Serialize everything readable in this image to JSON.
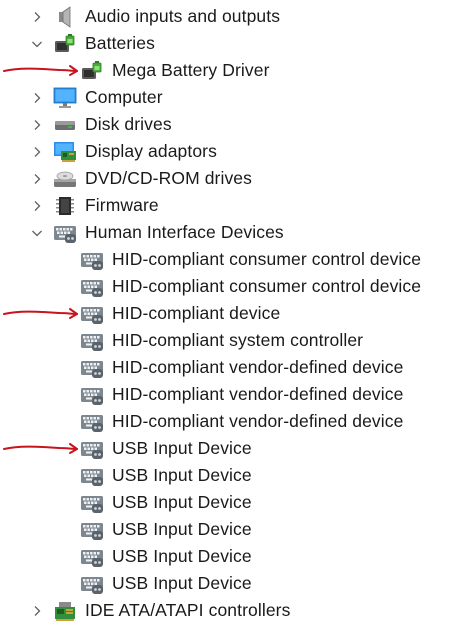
{
  "tree": {
    "categories": [
      {
        "label": "Audio inputs and outputs",
        "expanded": false,
        "icon": "speaker-icon"
      },
      {
        "label": "Batteries",
        "expanded": true,
        "icon": "battery-icon",
        "children": [
          {
            "label": "Mega Battery Driver",
            "icon": "battery-icon",
            "marked": true
          }
        ]
      },
      {
        "label": "Computer",
        "expanded": false,
        "icon": "monitor-icon"
      },
      {
        "label": "Disk drives",
        "expanded": false,
        "icon": "disk-drive-icon"
      },
      {
        "label": "Display adaptors",
        "expanded": false,
        "icon": "display-adapter-icon"
      },
      {
        "label": "DVD/CD-ROM drives",
        "expanded": false,
        "icon": "dvd-drive-icon"
      },
      {
        "label": "Firmware",
        "expanded": false,
        "icon": "chip-icon"
      },
      {
        "label": "Human Interface Devices",
        "expanded": true,
        "icon": "hid-icon",
        "children": [
          {
            "label": "HID-compliant consumer control device",
            "icon": "hid-icon"
          },
          {
            "label": "HID-compliant consumer control device",
            "icon": "hid-icon"
          },
          {
            "label": "HID-compliant device",
            "icon": "hid-icon",
            "marked": true
          },
          {
            "label": "HID-compliant system controller",
            "icon": "hid-icon"
          },
          {
            "label": "HID-compliant vendor-defined device",
            "icon": "hid-icon"
          },
          {
            "label": "HID-compliant vendor-defined device",
            "icon": "hid-icon"
          },
          {
            "label": "HID-compliant vendor-defined device",
            "icon": "hid-icon"
          },
          {
            "label": "USB Input Device",
            "icon": "hid-icon",
            "marked": true
          },
          {
            "label": "USB Input Device",
            "icon": "hid-icon"
          },
          {
            "label": "USB Input Device",
            "icon": "hid-icon"
          },
          {
            "label": "USB Input Device",
            "icon": "hid-icon"
          },
          {
            "label": "USB Input Device",
            "icon": "hid-icon"
          },
          {
            "label": "USB Input Device",
            "icon": "hid-icon"
          }
        ]
      },
      {
        "label": "IDE ATA/ATAPI controllers",
        "expanded": false,
        "icon": "ide-controller-icon"
      }
    ]
  },
  "colors": {
    "annotation": "#c8141e",
    "chevron": "#606060",
    "text": "#1a1a1a"
  }
}
